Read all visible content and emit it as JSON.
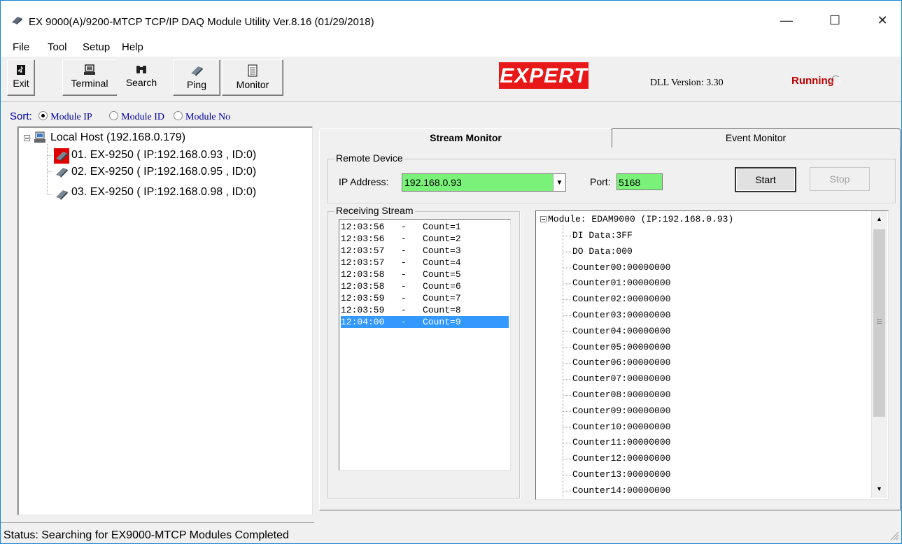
{
  "window": {
    "title": "EX 9000(A)/9200-MTCP TCP/IP DAQ Module Utility Ver.8.16 (01/29/2018)",
    "controls": {
      "minimize": "—",
      "maximize": "☐",
      "close": "✕"
    }
  },
  "menu": {
    "items": [
      {
        "label": "File"
      },
      {
        "label": "Tool"
      },
      {
        "label": "Setup"
      },
      {
        "label": "Help"
      }
    ]
  },
  "toolbar": {
    "buttons": [
      {
        "label": "Exit",
        "icon": "exit-icon"
      },
      {
        "label": "Terminal",
        "icon": "terminal-icon"
      },
      {
        "label": "Search",
        "icon": "binoculars-icon"
      },
      {
        "label": "Ping",
        "icon": "module-icon"
      },
      {
        "label": "Monitor",
        "icon": "monitor-icon"
      }
    ],
    "logo_text": "EXPERT",
    "dll_version": "DLL Version: 3.30",
    "running_label": "Running"
  },
  "sort": {
    "label": "Sort:",
    "options": [
      {
        "label": "Module IP",
        "selected": true
      },
      {
        "label": "Module ID",
        "selected": false
      },
      {
        "label": "Module No",
        "selected": false
      }
    ]
  },
  "tree": {
    "root": "Local Host (192.168.0.179)",
    "items": [
      "01. EX-9250 ( IP:192.168.0.93 , ID:0)",
      "02. EX-9250 ( IP:192.168.0.95 , ID:0)",
      "03. EX-9250 ( IP:192.168.0.98 , ID:0)"
    ]
  },
  "tabs": [
    {
      "label": "Stream Monitor",
      "active": true
    },
    {
      "label": "Event Monitor",
      "active": false
    }
  ],
  "remote_device": {
    "group_label": "Remote Device",
    "ip_label": "IP Address:",
    "ip_value": "192.168.0.93",
    "port_label": "Port:",
    "port_value": "5168",
    "start_label": "Start",
    "stop_label": "Stop"
  },
  "receiving_stream": {
    "group_label": "Receiving Stream",
    "rows": [
      {
        "time": "12:03:56",
        "count": "Count=1"
      },
      {
        "time": "12:03:56",
        "count": "Count=2"
      },
      {
        "time": "12:03:57",
        "count": "Count=3"
      },
      {
        "time": "12:03:57",
        "count": "Count=4"
      },
      {
        "time": "12:03:58",
        "count": "Count=5"
      },
      {
        "time": "12:03:58",
        "count": "Count=6"
      },
      {
        "time": "12:03:59",
        "count": "Count=7"
      },
      {
        "time": "12:03:59",
        "count": "Count=8"
      },
      {
        "time": "12:04:00",
        "count": "Count=9"
      }
    ]
  },
  "data_tree": {
    "root": "Module: EDAM9000 (IP:192.168.0.93)",
    "items": [
      "DI Data:3FF",
      "DO Data:000",
      "Counter00:00000000",
      "Counter01:00000000",
      "Counter02:00000000",
      "Counter03:00000000",
      "Counter04:00000000",
      "Counter05:00000000",
      "Counter06:00000000",
      "Counter07:00000000",
      "Counter08:00000000",
      "Counter09:00000000",
      "Counter10:00000000",
      "Counter11:00000000",
      "Counter12:00000000",
      "Counter13:00000000",
      "Counter14:00000000"
    ]
  },
  "status": {
    "text": "Status: Searching for EX9000-MTCP Modules Completed"
  },
  "colors": {
    "accent_green": "#7af27a",
    "selection_blue": "#3399ff",
    "running_red": "#c00000",
    "logo_red": "#e81818"
  }
}
